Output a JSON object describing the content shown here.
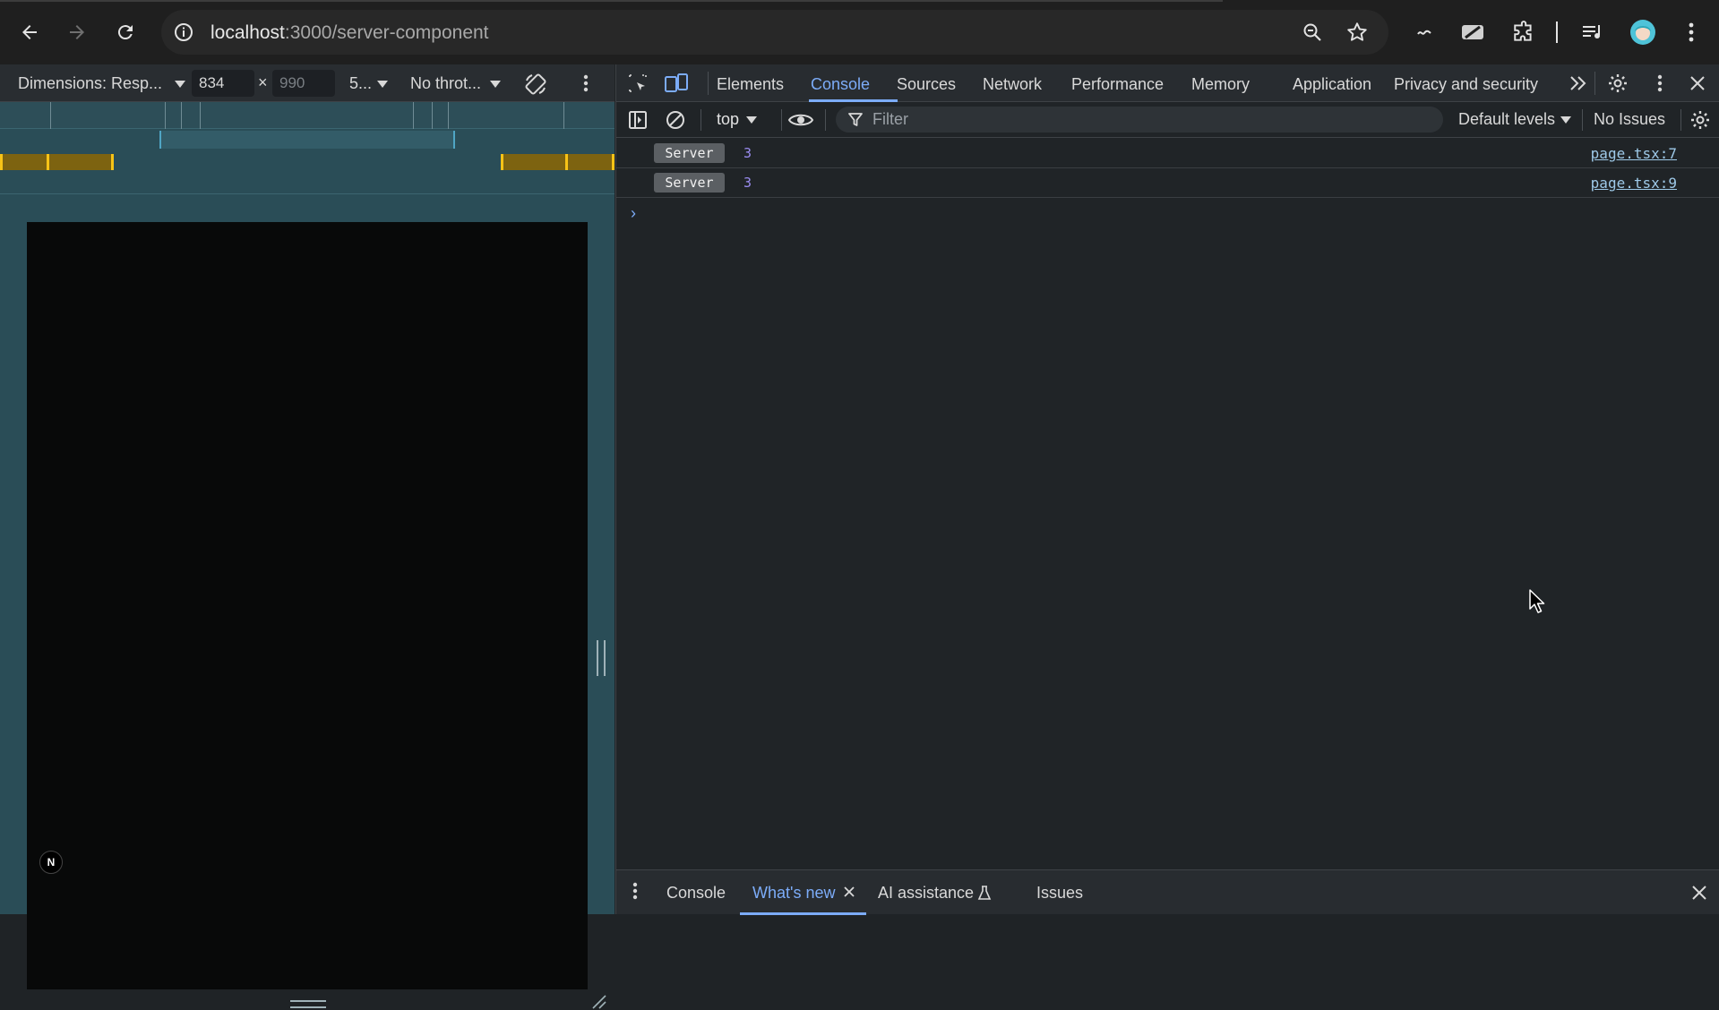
{
  "browser": {
    "url_host": "localhost",
    "url_path": ":3000/server-component",
    "nav_icons": [
      "back-arrow-icon",
      "forward-arrow-icon",
      "reload-icon",
      "site-info-icon"
    ],
    "toolbar_icons": [
      "zoom-icon",
      "bookmark-star-icon",
      "extension-icon",
      "media-icon",
      "profile-avatar-icon",
      "menu-icon"
    ]
  },
  "device_toolbar": {
    "dimensions_label": "Dimensions: Resp...",
    "width_value": "834",
    "height_value": "990",
    "zoom_label": "5...",
    "throttle_label": "No throt..."
  },
  "devtools": {
    "tabs": [
      "Elements",
      "Console",
      "Sources",
      "Network",
      "Performance",
      "Memory",
      "Application",
      "Privacy and security"
    ],
    "active_tab": "Console",
    "console_toolbar": {
      "context": "top",
      "filter_placeholder": "Filter",
      "levels": "Default levels",
      "issues": "No Issues"
    },
    "logs": [
      {
        "badge": "Server",
        "value": "3",
        "source": "page.tsx:7"
      },
      {
        "badge": "Server",
        "value": "3",
        "source": "page.tsx:9"
      }
    ],
    "prompt": "›",
    "drawer_tabs": {
      "console": "Console",
      "whats_new": "What's new",
      "ai_assistance": "AI assistance",
      "issues": "Issues"
    }
  },
  "page": {
    "next_badge": "N"
  },
  "colors": {
    "accent": "#7cacf8",
    "device_bg": "#2a4d57",
    "media_query_yellow": "#f7c317"
  }
}
